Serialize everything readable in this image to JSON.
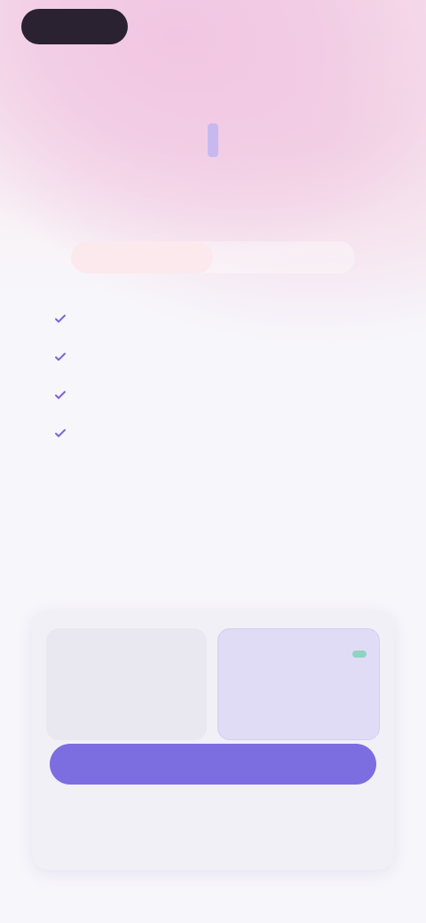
{
  "topbar": {
    "logo_label": "",
    "link_label": ""
  },
  "hero": {
    "line1": "",
    "line2_accent": "",
    "line2_rest": ""
  },
  "plan_tabs": [
    {
      "label": "",
      "active": true
    },
    {
      "label": "",
      "active": false
    }
  ],
  "features": [
    {
      "text": "",
      "icon": "check-icon"
    },
    {
      "text": "",
      "icon": "check-icon"
    },
    {
      "text": "",
      "icon": "check-icon"
    },
    {
      "text": "",
      "icon": "check-icon"
    }
  ],
  "info": {
    "text": "",
    "link_label": ""
  },
  "pricing": {
    "options": [
      {
        "label": "",
        "price": "",
        "unit": "",
        "badge": "",
        "selected": false
      },
      {
        "label": "",
        "price": "",
        "unit": "",
        "badge": "",
        "selected": true
      }
    ],
    "cta_label": "",
    "note": "",
    "footer": ""
  },
  "colors": {
    "accent": "#7c6ee0",
    "badge": "#8fd3c3",
    "hero_highlight": "#c7b9ef"
  }
}
